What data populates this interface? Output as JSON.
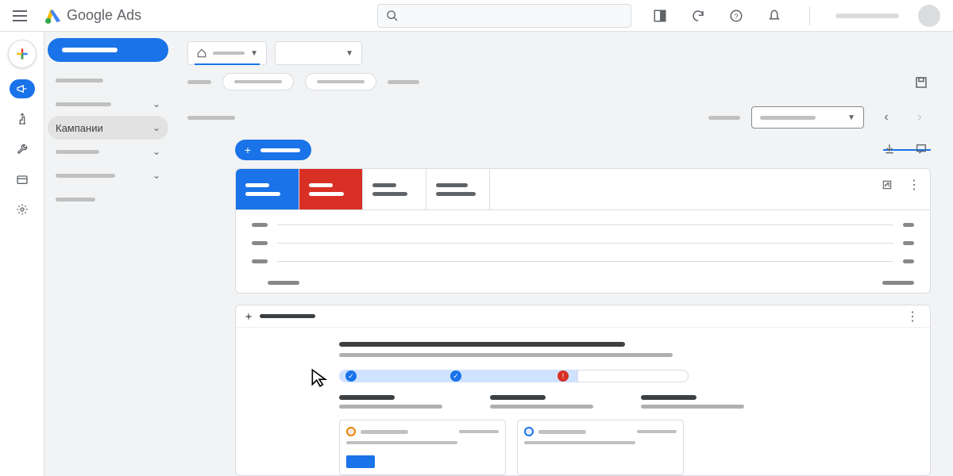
{
  "app": {
    "brand": "Google",
    "product": "Ads"
  },
  "search": {
    "placeholder": ""
  },
  "sidenav": {
    "campaigns_label": "Кампании"
  },
  "colors": {
    "primary": "#1a73e8",
    "danger": "#d93025",
    "grey": "#5f6368"
  },
  "scorecard": {
    "tabs": [
      {
        "color": "blue"
      },
      {
        "color": "red"
      },
      {
        "color": "white"
      },
      {
        "color": "white"
      }
    ],
    "rows": 3
  },
  "guide": {
    "progress": {
      "checkpoints": [
        {
          "type": "check",
          "pos": 8
        },
        {
          "type": "check",
          "pos": 140
        },
        {
          "type": "warn",
          "pos": 275
        }
      ]
    }
  }
}
